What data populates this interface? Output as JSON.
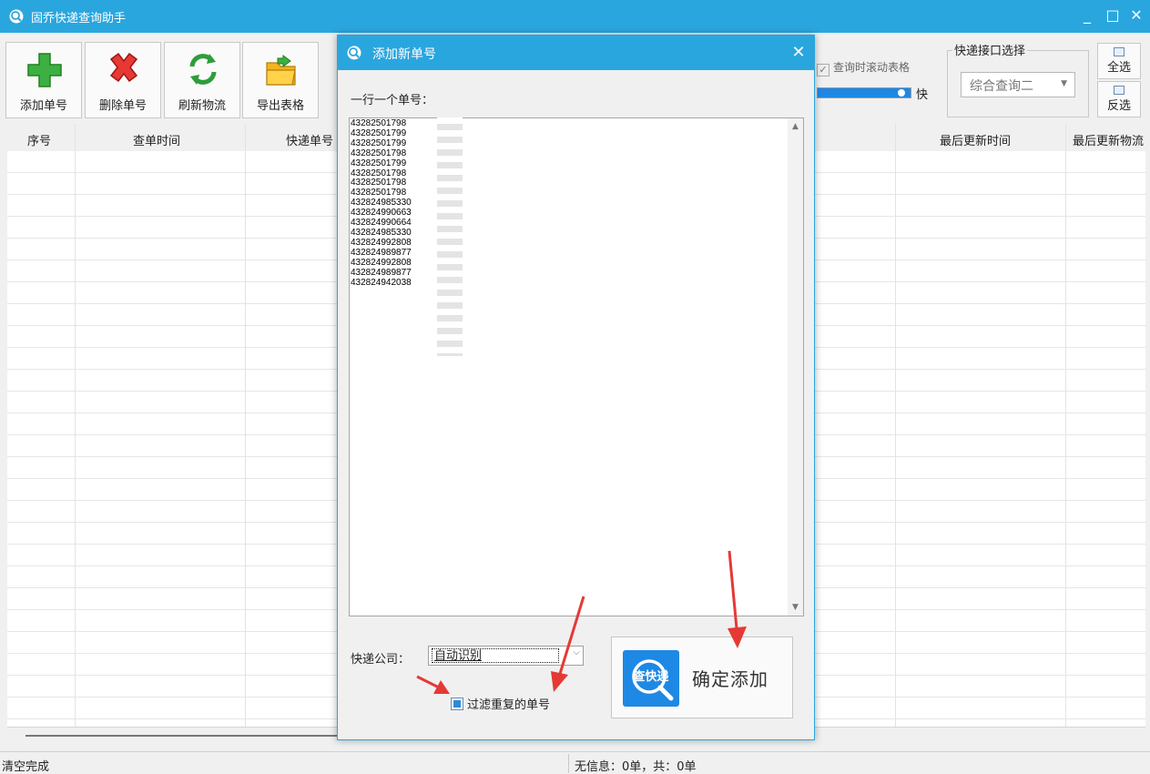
{
  "window": {
    "title": "固乔快递查询助手",
    "controls": {
      "minimize": "_",
      "maximize": "□",
      "close": "✕"
    },
    "accent_color": "#2aa6de"
  },
  "toolbar": {
    "buttons": [
      {
        "label": "添加单号",
        "icon": "add-icon"
      },
      {
        "label": "删除单号",
        "icon": "delete-icon"
      },
      {
        "label": "刷新物流",
        "icon": "refresh-icon"
      },
      {
        "label": "导出表格",
        "icon": "export-folder-icon"
      }
    ],
    "scroll_checkbox": {
      "label": "查询时滚动表格",
      "checked": true
    },
    "speed": {
      "label": "快",
      "level": 1.0
    },
    "api_group": {
      "legend": "快递接口选择",
      "selected": "综合查询二"
    },
    "select_all_label": "全选",
    "invert_label": "反选"
  },
  "table": {
    "columns": [
      "序号",
      "查单时间",
      "快递单号",
      "最后更新时间",
      "最后更新物流"
    ]
  },
  "status": {
    "left": "清空完成",
    "right": "无信息：0单，共：0单"
  },
  "dialog": {
    "title": "添加新单号",
    "close": "✕",
    "prompt": "一行一个单号：",
    "tracking_numbers": [
      "43282501798",
      "43282501799",
      "43282501799",
      "43282501798",
      "43282501799",
      "43282501798",
      "43282501798",
      "43282501798",
      "432824985330",
      "432824990663",
      "432824990664",
      "432824985330",
      "432824992808",
      "432824989877",
      "432824992808",
      "432824989877",
      "432824942038"
    ],
    "company_label": "快递公司：",
    "company_selected": "自动识别",
    "filter_label": "过滤重复的单号",
    "filter_checked": true,
    "confirm_logo_text": "查快递",
    "confirm_label": "确定添加"
  }
}
